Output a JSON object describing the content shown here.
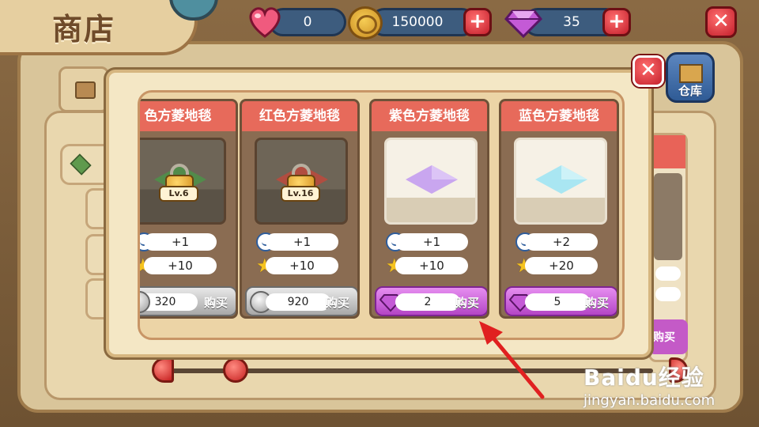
{
  "screen_title": "商店",
  "currencies": {
    "hearts": "0",
    "coins": "150000",
    "gems": "35"
  },
  "buttons": {
    "plus_symbol": "+",
    "close_symbol": "✕",
    "warehouse_label": "仓库",
    "buy_label": "购买"
  },
  "items": [
    {
      "name": "色方菱地毯",
      "locked": true,
      "level": "Lv.6",
      "rug_color": "#4f8f4a",
      "comfort": "+1",
      "exp": "+10",
      "price": "320",
      "currency": "silver-coin"
    },
    {
      "name": "红色方菱地毯",
      "locked": true,
      "level": "Lv.16",
      "rug_color": "#b84a3e",
      "comfort": "+1",
      "exp": "+10",
      "price": "920",
      "currency": "silver-coin"
    },
    {
      "name": "紫色方菱地毯",
      "locked": false,
      "rug_color": "#c9a6ef",
      "comfort": "+1",
      "exp": "+10",
      "price": "2",
      "currency": "gem"
    },
    {
      "name": "蓝色方菱地毯",
      "locked": false,
      "rug_color": "#a9e6f2",
      "comfort": "+2",
      "exp": "+20",
      "price": "5",
      "currency": "gem"
    }
  ],
  "background": {
    "buy_label": "购买"
  },
  "watermark": {
    "main": "Baidu经验",
    "sub": "jingyan.baidu.com"
  },
  "colors": {
    "header_red": "#e76a5b",
    "buy_purple": "#b445c5",
    "annotation_arrow": "#e02020"
  }
}
